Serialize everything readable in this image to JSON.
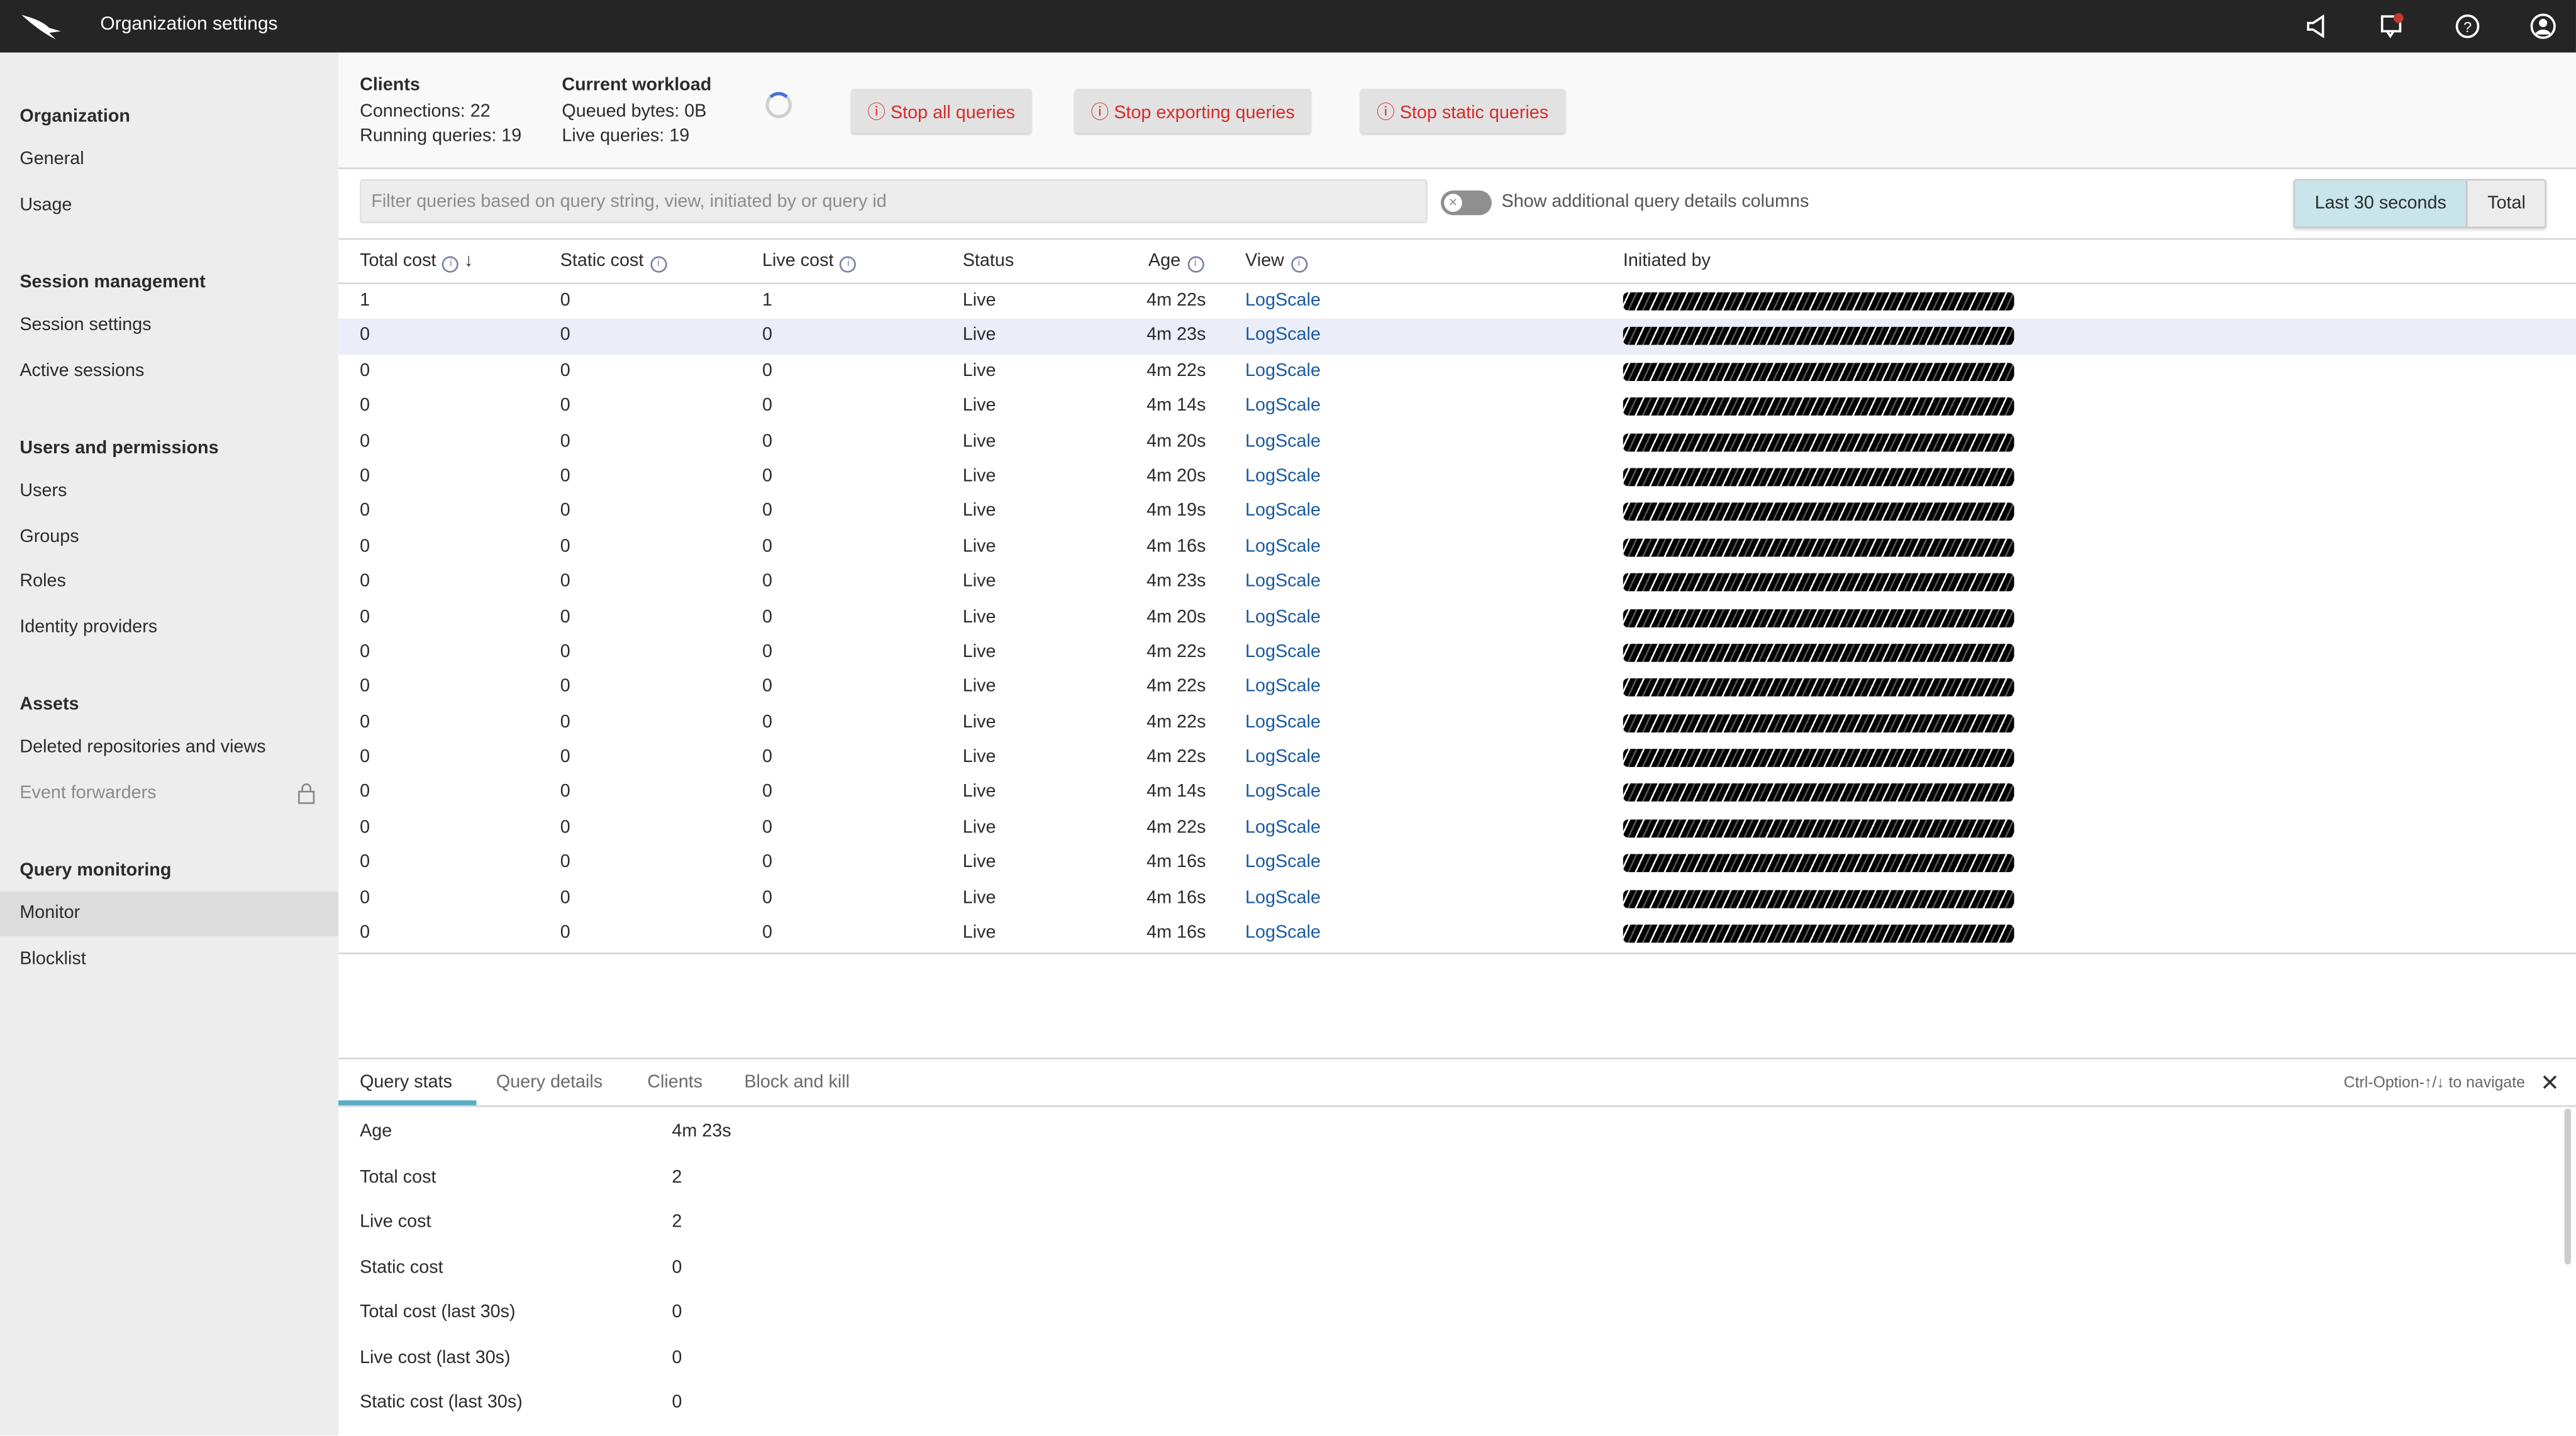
{
  "topbar": {
    "title": "Organization settings",
    "icons": [
      "falcon-logo",
      "megaphone-icon",
      "notifications-icon",
      "help-icon",
      "user-icon"
    ],
    "notification_color": "#c0392b"
  },
  "sidebar": {
    "sections": [
      {
        "title": "Organization",
        "items": [
          {
            "label": "General"
          },
          {
            "label": "Usage"
          }
        ]
      },
      {
        "title": "Session management",
        "items": [
          {
            "label": "Session settings"
          },
          {
            "label": "Active sessions"
          }
        ]
      },
      {
        "title": "Users and permissions",
        "items": [
          {
            "label": "Users"
          },
          {
            "label": "Groups"
          },
          {
            "label": "Roles"
          },
          {
            "label": "Identity providers"
          }
        ]
      },
      {
        "title": "Assets",
        "items": [
          {
            "label": "Deleted repositories and views"
          },
          {
            "label": "Event forwarders",
            "locked": true
          }
        ]
      },
      {
        "title": "Query monitoring",
        "items": [
          {
            "label": "Monitor",
            "active": true
          },
          {
            "label": "Blocklist"
          }
        ]
      }
    ]
  },
  "summary": {
    "clients_title": "Clients",
    "connections": "Connections: 22",
    "running": "Running queries: 19",
    "workload_title": "Current workload",
    "queued": "Queued bytes: 0B",
    "live": "Live queries: 19",
    "buttons": [
      "Stop all queries",
      "Stop exporting queries",
      "Stop static queries"
    ],
    "danger_color": "#d72b2b"
  },
  "filter": {
    "placeholder": "Filter queries based on query string, view, initiated by or query id",
    "value": "",
    "toggle_label": "Show additional query details columns",
    "toggle_on": false,
    "segments": [
      "Last 30 seconds",
      "Total"
    ],
    "selected_segment": "Last 30 seconds"
  },
  "table": {
    "columns": [
      "Total cost",
      "Static cost",
      "Live cost",
      "Status",
      "Age",
      "View",
      "Initiated by"
    ],
    "sort": {
      "column": "Total cost",
      "direction": "descending"
    },
    "rows": [
      [
        "1",
        "0",
        "1",
        "Live",
        "4m 22s",
        "LogScale"
      ],
      [
        "0",
        "0",
        "0",
        "Live",
        "4m 23s",
        "LogScale"
      ],
      [
        "0",
        "0",
        "0",
        "Live",
        "4m 22s",
        "LogScale"
      ],
      [
        "0",
        "0",
        "0",
        "Live",
        "4m 14s",
        "LogScale"
      ],
      [
        "0",
        "0",
        "0",
        "Live",
        "4m 20s",
        "LogScale"
      ],
      [
        "0",
        "0",
        "0",
        "Live",
        "4m 20s",
        "LogScale"
      ],
      [
        "0",
        "0",
        "0",
        "Live",
        "4m 19s",
        "LogScale"
      ],
      [
        "0",
        "0",
        "0",
        "Live",
        "4m 16s",
        "LogScale"
      ],
      [
        "0",
        "0",
        "0",
        "Live",
        "4m 23s",
        "LogScale"
      ],
      [
        "0",
        "0",
        "0",
        "Live",
        "4m 20s",
        "LogScale"
      ],
      [
        "0",
        "0",
        "0",
        "Live",
        "4m 22s",
        "LogScale"
      ],
      [
        "0",
        "0",
        "0",
        "Live",
        "4m 22s",
        "LogScale"
      ],
      [
        "0",
        "0",
        "0",
        "Live",
        "4m 22s",
        "LogScale"
      ],
      [
        "0",
        "0",
        "0",
        "Live",
        "4m 22s",
        "LogScale"
      ],
      [
        "0",
        "0",
        "0",
        "Live",
        "4m 14s",
        "LogScale"
      ],
      [
        "0",
        "0",
        "0",
        "Live",
        "4m 22s",
        "LogScale"
      ],
      [
        "0",
        "0",
        "0",
        "Live",
        "4m 16s",
        "LogScale"
      ],
      [
        "0",
        "0",
        "0",
        "Live",
        "4m 16s",
        "LogScale"
      ],
      [
        "0",
        "0",
        "0",
        "Live",
        "4m 16s",
        "LogScale"
      ]
    ],
    "selected_row": 1
  },
  "details": {
    "tabs": [
      "Query stats",
      "Query details",
      "Clients",
      "Block and kill"
    ],
    "active_tab": "Query stats",
    "hint": "Ctrl-Option-↑/↓ to navigate",
    "stats": [
      [
        "Age",
        "4m 23s"
      ],
      [
        "Total cost",
        "2"
      ],
      [
        "Live cost",
        "2"
      ],
      [
        "Static cost",
        "0"
      ],
      [
        "Total cost (last 30s)",
        "0"
      ],
      [
        "Live cost (last 30s)",
        "0"
      ],
      [
        "Static cost (last 30s)",
        "0"
      ]
    ]
  }
}
